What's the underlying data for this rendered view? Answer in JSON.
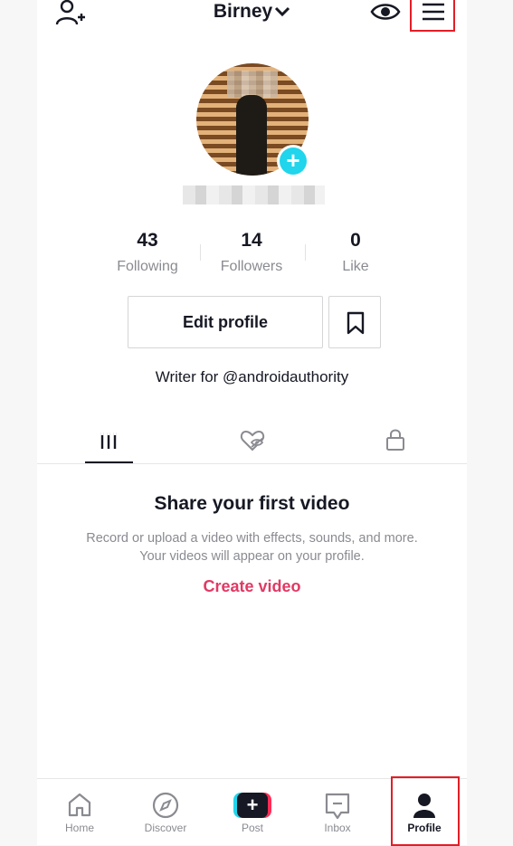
{
  "header": {
    "title": "Birney",
    "add_user_icon": "add-user-icon",
    "eye_icon": "eye-icon",
    "menu_icon": "hamburger-menu-icon",
    "highlight_color": "#e21e26"
  },
  "profile": {
    "avatar_badge_icon": "plus-icon",
    "badge_glyph": "+",
    "badge_color": "#20d5ec"
  },
  "stats": [
    {
      "value": "43",
      "label": "Following"
    },
    {
      "value": "14",
      "label": "Followers"
    },
    {
      "value": "0",
      "label": "Like"
    }
  ],
  "actions": {
    "edit_profile": "Edit profile",
    "bookmark_icon": "bookmark-icon"
  },
  "bio": "Writer for @androidauthority",
  "tabs": [
    {
      "icon": "videos-grid-icon",
      "active": true
    },
    {
      "icon": "liked-hidden-heart-icon",
      "active": false
    },
    {
      "icon": "lock-icon",
      "active": false
    }
  ],
  "empty_state": {
    "title": "Share your first video",
    "description": "Record or upload a video with effects, sounds, and more. Your videos will appear on your profile.",
    "cta": "Create video",
    "cta_color": "#e03a64"
  },
  "bottom_nav": {
    "home": "Home",
    "discover": "Discover",
    "post": "Post",
    "post_glyph": "+",
    "inbox": "Inbox",
    "profile": "Profile"
  }
}
